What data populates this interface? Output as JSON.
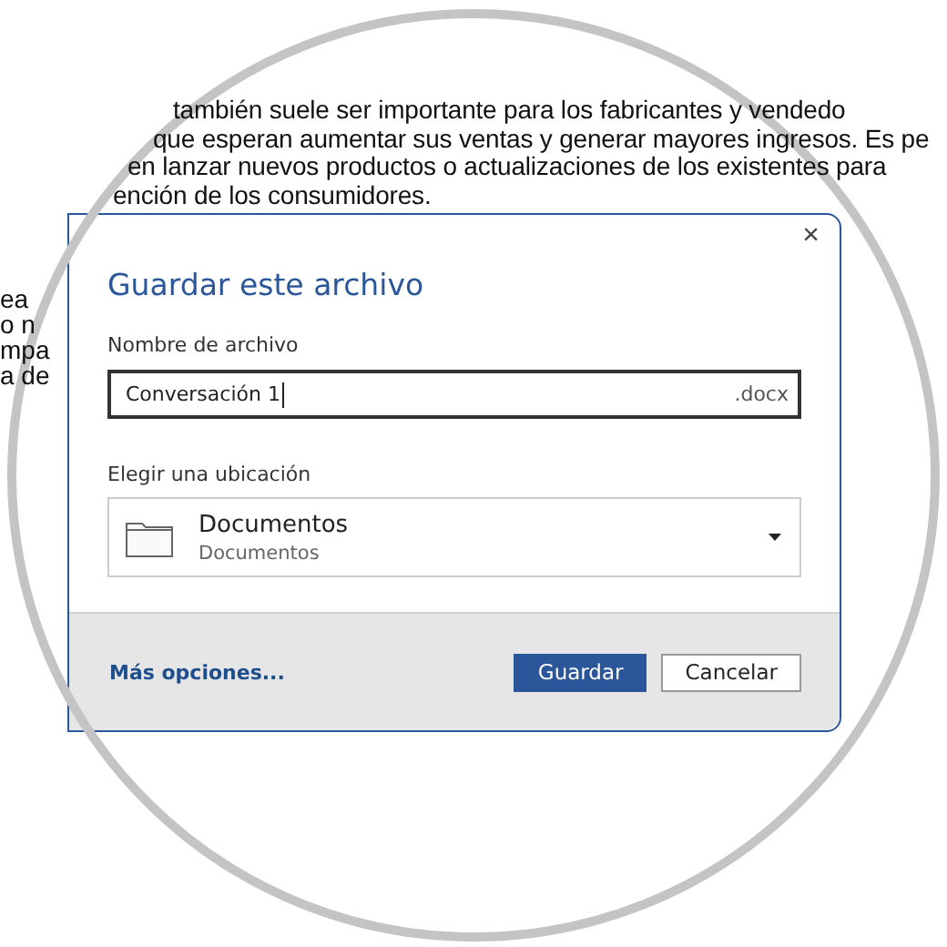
{
  "document": {
    "lines": [
      "también suele ser importante para los fabricantes y vendedo",
      "que esperan aumentar sus ventas y generar mayores ingresos. Es pe",
      "en lanzar nuevos productos o actualizaciones de los existentes para",
      "ención de los consumidores."
    ],
    "side_fragments": [
      "ea",
      "o n",
      "mpa",
      "a de"
    ]
  },
  "dialog": {
    "title": "Guardar este archivo",
    "close": "×",
    "filename": {
      "label": "Nombre de archivo",
      "value": "Conversación 1",
      "extension": ".docx"
    },
    "location": {
      "label": "Elegir una ubicación",
      "name": "Documentos",
      "path": "Documentos"
    },
    "more_options": "Más opciones...",
    "buttons": [
      {
        "label": "Guardar",
        "kind": "primary"
      },
      {
        "label": "Cancelar",
        "kind": "secondary"
      }
    ]
  }
}
